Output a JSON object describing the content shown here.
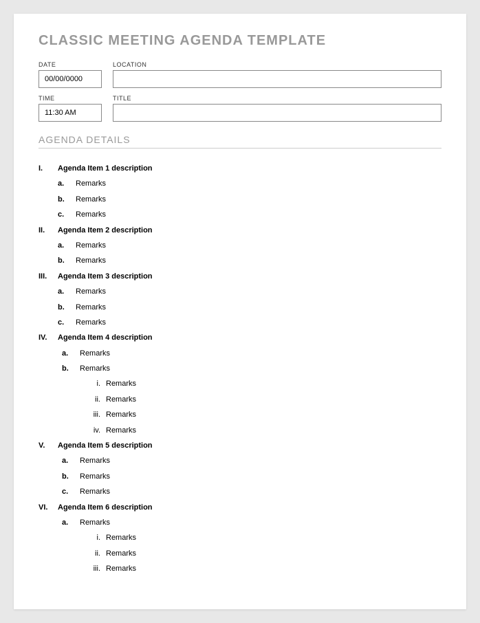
{
  "title": "CLASSIC MEETING AGENDA TEMPLATE",
  "fields": {
    "date": {
      "label": "DATE",
      "value": "00/00/0000"
    },
    "location": {
      "label": "LOCATION",
      "value": ""
    },
    "time": {
      "label": "TIME",
      "value": "11:30 AM"
    },
    "titleField": {
      "label": "TITLE",
      "value": ""
    }
  },
  "sectionHeader": "AGENDA DETAILS",
  "agenda": [
    {
      "marker": "I.",
      "text": "Agenda Item 1 description",
      "remarks": [
        {
          "marker": "a.",
          "text": "Remarks"
        },
        {
          "marker": "b.",
          "text": "Remarks"
        },
        {
          "marker": "c.",
          "text": "Remarks"
        }
      ]
    },
    {
      "marker": "II.",
      "text": "Agenda Item 2 description",
      "remarks": [
        {
          "marker": "a.",
          "text": "Remarks"
        },
        {
          "marker": "b.",
          "text": "Remarks"
        }
      ]
    },
    {
      "marker": "III.",
      "text": "Agenda Item 3 description",
      "remarks": [
        {
          "marker": "a.",
          "text": "Remarks"
        },
        {
          "marker": "b.",
          "text": "Remarks"
        },
        {
          "marker": "c.",
          "text": "Remarks"
        }
      ]
    },
    {
      "marker": "IV.",
      "text": "Agenda Item 4 description",
      "remarksIndented": [
        {
          "marker": "a.",
          "text": "Remarks"
        },
        {
          "marker": "b.",
          "text": "Remarks",
          "sub": [
            {
              "marker": "i.",
              "text": "Remarks"
            },
            {
              "marker": "ii.",
              "text": "Remarks"
            },
            {
              "marker": "iii.",
              "text": "Remarks"
            },
            {
              "marker": "iv.",
              "text": "Remarks"
            }
          ]
        }
      ]
    },
    {
      "marker": "V.",
      "text": "Agenda Item 5 description",
      "remarksIndented": [
        {
          "marker": "a.",
          "text": "Remarks"
        },
        {
          "marker": "b.",
          "text": "Remarks"
        },
        {
          "marker": "c.",
          "text": "Remarks"
        }
      ]
    },
    {
      "marker": "VI.",
      "text": "Agenda Item 6 description",
      "remarksIndented": [
        {
          "marker": "a.",
          "text": "Remarks",
          "sub": [
            {
              "marker": "i.",
              "text": "Remarks"
            },
            {
              "marker": "ii.",
              "text": "Remarks"
            },
            {
              "marker": "iii.",
              "text": "Remarks"
            }
          ]
        }
      ]
    }
  ]
}
